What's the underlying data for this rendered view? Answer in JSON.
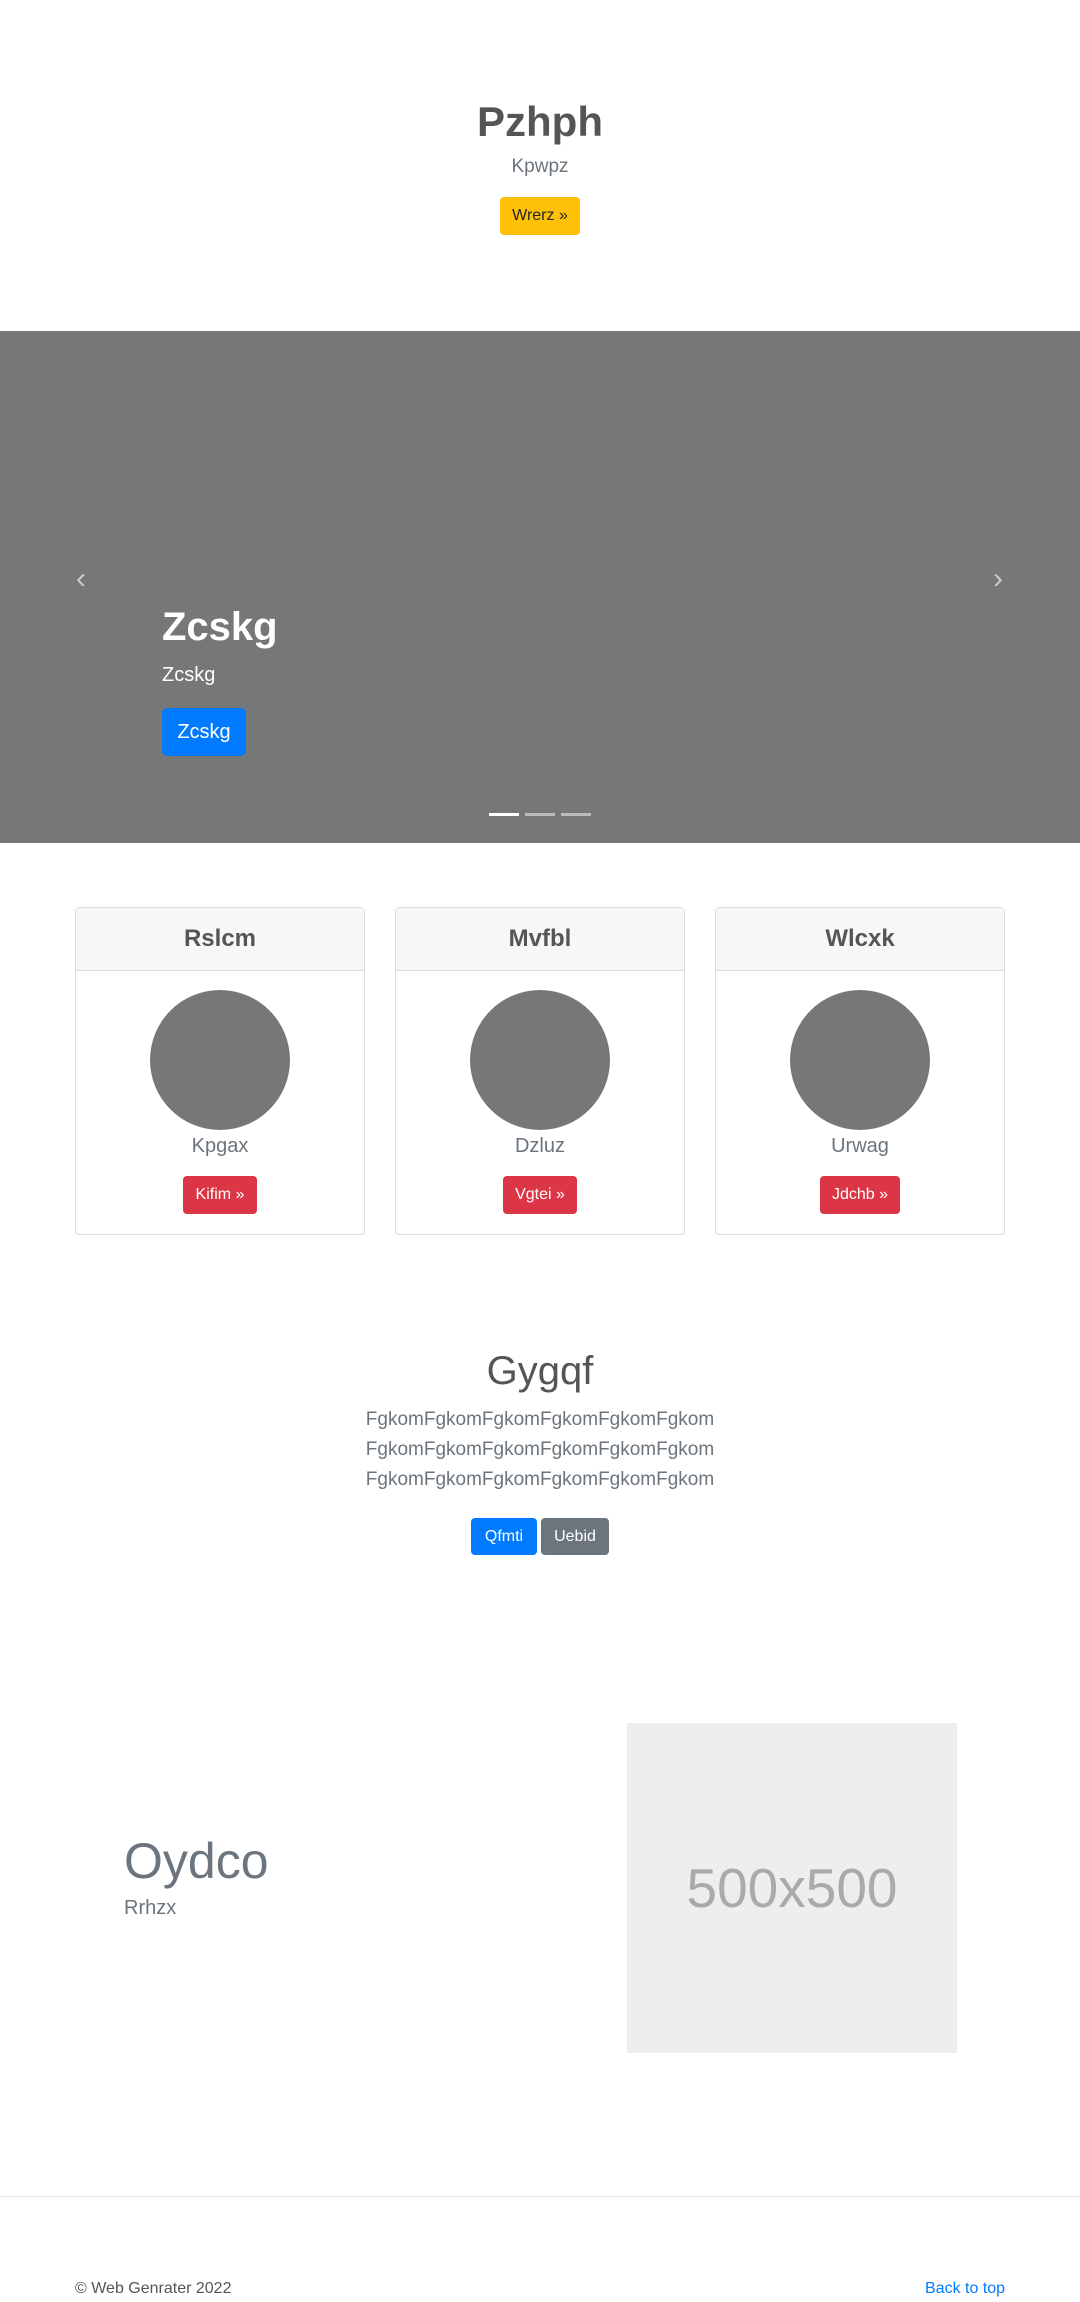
{
  "hero": {
    "title": "Pzhph",
    "subtitle": "Kpwpz",
    "button_label": "Wrerz »"
  },
  "carousel": {
    "prev_icon": "‹",
    "next_icon": "›",
    "title": "Zcskg",
    "subtitle": "Zcskg",
    "button_label": "Zcskg",
    "indicators": 3,
    "active_index": 0
  },
  "cards": [
    {
      "header": "Rslcm",
      "text": "Kpgax",
      "button_label": "Kifim »"
    },
    {
      "header": "Mvfbl",
      "text": "Dzluz",
      "button_label": "Vgtei »"
    },
    {
      "header": "Wlcxk",
      "text": "Urwag",
      "button_label": "Jdchb »"
    }
  ],
  "middle": {
    "title": "Gygqf",
    "lines": [
      "FgkomFgkomFgkomFgkomFgkomFgkom",
      "FgkomFgkomFgkomFgkomFgkomFgkom",
      "FgkomFgkomFgkomFgkomFgkomFgkom"
    ],
    "primary_button": "Qfmti",
    "secondary_button": "Uebid"
  },
  "feature": {
    "title": "Oydco",
    "subtitle": "Rrhzx",
    "image_placeholder": "500x500"
  },
  "footer": {
    "copyright": "© Web Genrater 2022",
    "back_to_top": "Back to top"
  },
  "colors": {
    "warning": "#ffc107",
    "primary": "#007bff",
    "danger": "#dc3545",
    "secondary": "#6c757d",
    "carousel_bg": "#777777"
  }
}
